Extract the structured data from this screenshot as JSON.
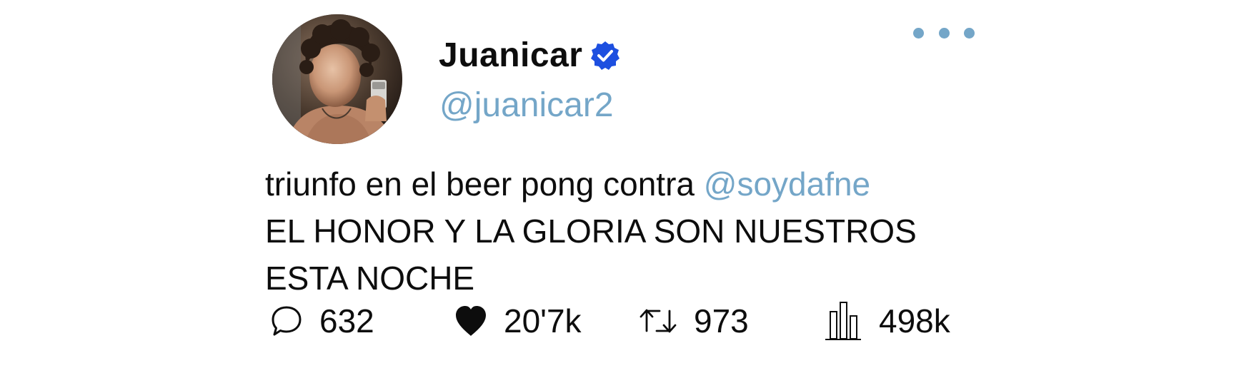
{
  "author": {
    "display_name": "Juanicar",
    "handle": "@juanicar2",
    "verified": true,
    "avatar_icon": "profile-photo-avatar"
  },
  "menu": {
    "icon": "more-options-icon"
  },
  "tweet": {
    "text_before_mention": "triunfo en el beer pong contra ",
    "mention": "@soydafne",
    "line2": "EL HONOR Y LA GLORIA SON NUESTROS",
    "line3": "ESTA NOCHE"
  },
  "stats": {
    "replies": "632",
    "likes": "20'7k",
    "retweets": "973",
    "views": "498k"
  },
  "colors": {
    "link": "#74a6c8",
    "verified_badge": "#1d4fe0",
    "text": "#0d0d0d"
  }
}
